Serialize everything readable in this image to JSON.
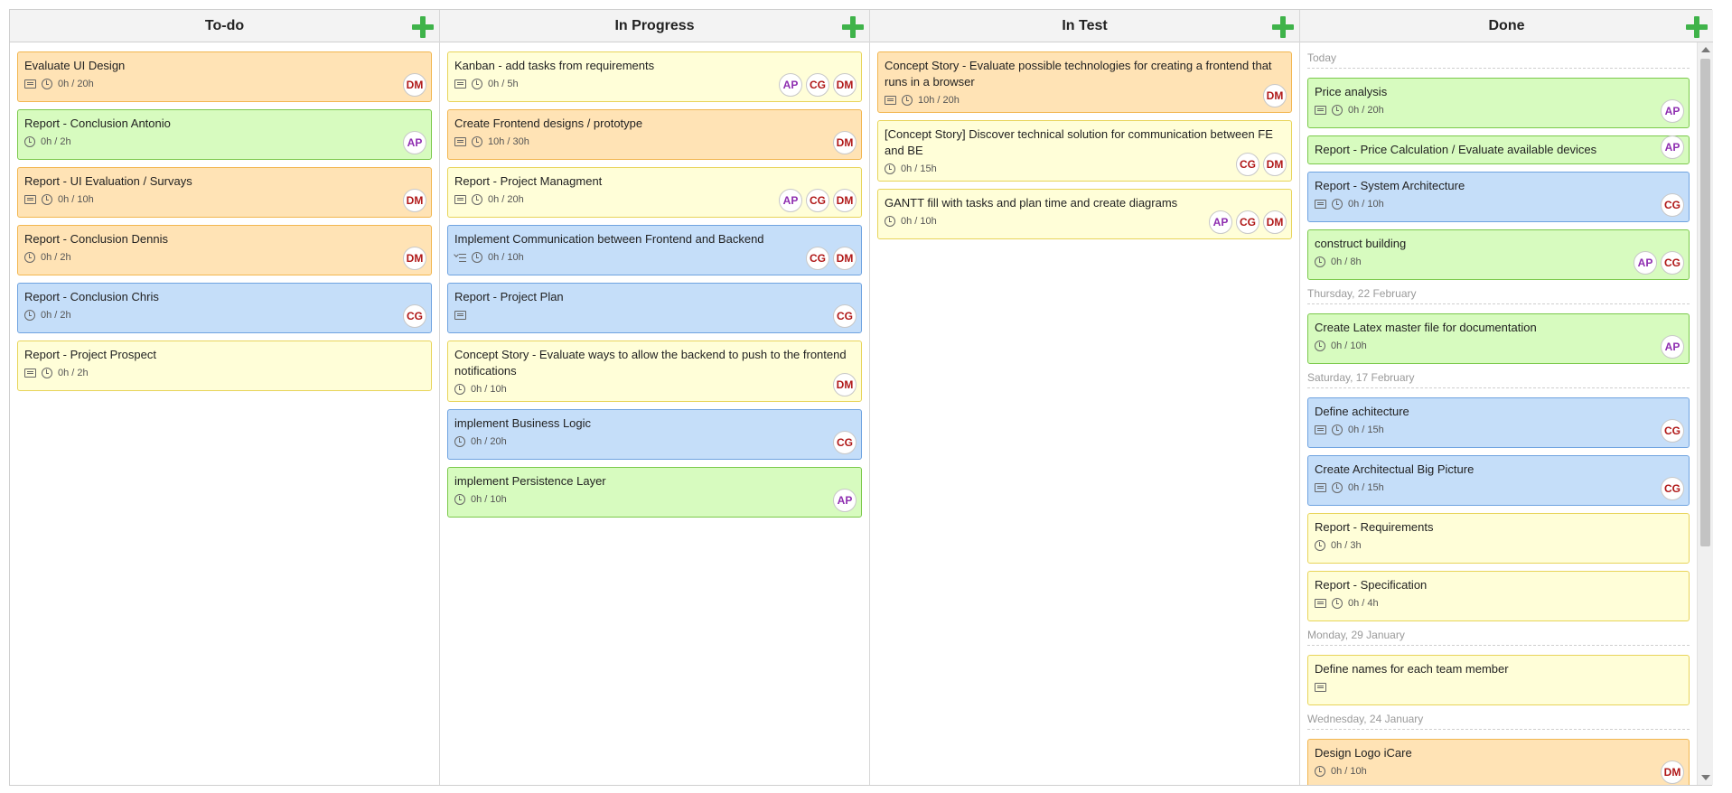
{
  "colors": {
    "orange": "#ffe3b5",
    "green": "#d7fbbf",
    "blue": "#c5def9",
    "yellow": "#fffed8",
    "add": "#3fb34a"
  },
  "columns": [
    {
      "title": "To-do",
      "cards": [
        {
          "title": "Evaluate UI Design",
          "color": "orange",
          "desc": true,
          "time": "0h / 20h",
          "avatars": [
            "DM"
          ]
        },
        {
          "title": "Report - Conclusion Antonio",
          "color": "green",
          "desc": false,
          "time": "0h / 2h",
          "avatars": [
            "AP"
          ]
        },
        {
          "title": "Report - UI Evaluation / Survays",
          "color": "orange",
          "desc": true,
          "time": "0h / 10h",
          "avatars": [
            "DM"
          ]
        },
        {
          "title": "Report - Conclusion Dennis",
          "color": "orange",
          "desc": false,
          "time": "0h / 2h",
          "avatars": [
            "DM"
          ]
        },
        {
          "title": "Report - Conclusion Chris",
          "color": "blue",
          "desc": false,
          "time": "0h / 2h",
          "avatars": [
            "CG"
          ]
        },
        {
          "title": "Report - Project Prospect",
          "color": "yellow",
          "desc": true,
          "time": "0h / 2h",
          "avatars": []
        }
      ]
    },
    {
      "title": "In Progress",
      "cards": [
        {
          "title": "Kanban - add tasks from requirements",
          "color": "yellow",
          "desc": true,
          "time": "0h / 5h",
          "avatars": [
            "AP",
            "CG",
            "DM"
          ]
        },
        {
          "title": "Create Frontend designs / prototype",
          "color": "orange",
          "desc": true,
          "time": "10h / 30h",
          "avatars": [
            "DM"
          ]
        },
        {
          "title": "Report - Project Managment",
          "color": "yellow",
          "desc": true,
          "time": "0h / 20h",
          "avatars": [
            "AP",
            "CG",
            "DM"
          ]
        },
        {
          "title": "Implement Communication between Frontend and Backend",
          "color": "blue",
          "checklist": true,
          "time": "0h / 10h",
          "avatars": [
            "CG",
            "DM"
          ]
        },
        {
          "title": "Report - Project Plan",
          "color": "blue",
          "desc": true,
          "time": "",
          "avatars": [
            "CG"
          ]
        },
        {
          "title": "Concept Story - Evaluate ways to allow the backend to push to the frontend notifications",
          "color": "yellow",
          "desc": false,
          "time": "0h / 10h",
          "avatars": [
            "DM"
          ]
        },
        {
          "title": "implement Business Logic",
          "color": "blue",
          "desc": false,
          "time": "0h / 20h",
          "avatars": [
            "CG"
          ]
        },
        {
          "title": "implement Persistence Layer",
          "color": "green",
          "desc": false,
          "time": "0h / 10h",
          "avatars": [
            "AP"
          ]
        }
      ]
    },
    {
      "title": "In Test",
      "cards": [
        {
          "title": "Concept Story - Evaluate possible technologies for creating a frontend that runs in a browser",
          "color": "orange",
          "desc": true,
          "time": "10h / 20h",
          "avatars": [
            "DM"
          ]
        },
        {
          "title": "[Concept Story] Discover technical solution for communication between FE and BE",
          "color": "yellow",
          "desc": false,
          "time": "0h / 15h",
          "avatars": [
            "CG",
            "DM"
          ]
        },
        {
          "title": "GANTT fill with tasks and plan time and create diagrams",
          "color": "yellow",
          "desc": false,
          "time": "0h / 10h",
          "avatars": [
            "AP",
            "CG",
            "DM"
          ]
        }
      ]
    },
    {
      "title": "Done",
      "groups": [
        {
          "label": "Today",
          "cards": [
            {
              "title": "Price analysis",
              "color": "green",
              "desc": true,
              "time": "0h / 20h",
              "avatars": [
                "AP"
              ]
            },
            {
              "title": "Report - Price Calculation / Evaluate available devices",
              "color": "green",
              "desc": false,
              "time": "",
              "avatars": [
                "AP"
              ],
              "compact": true
            },
            {
              "title": "Report - System Architecture",
              "color": "blue",
              "desc": true,
              "time": "0h / 10h",
              "avatars": [
                "CG"
              ]
            },
            {
              "title": "construct building",
              "color": "green",
              "desc": false,
              "time": "0h / 8h",
              "avatars": [
                "AP",
                "CG"
              ]
            }
          ]
        },
        {
          "label": "Thursday, 22 February",
          "cards": [
            {
              "title": "Create Latex master file for documentation",
              "color": "green",
              "desc": false,
              "time": "0h / 10h",
              "avatars": [
                "AP"
              ]
            }
          ]
        },
        {
          "label": "Saturday, 17 February",
          "cards": [
            {
              "title": "Define achitecture",
              "color": "blue",
              "desc": true,
              "time": "0h / 15h",
              "avatars": [
                "CG"
              ]
            },
            {
              "title": "Create Architectual Big Picture",
              "color": "blue",
              "desc": true,
              "time": "0h / 15h",
              "avatars": [
                "CG"
              ]
            },
            {
              "title": "Report - Requirements",
              "color": "yellow",
              "desc": false,
              "time": "0h / 3h",
              "avatars": []
            },
            {
              "title": "Report - Specification",
              "color": "yellow",
              "desc": true,
              "time": "0h / 4h",
              "avatars": []
            }
          ]
        },
        {
          "label": "Monday, 29 January",
          "cards": [
            {
              "title": "Define names for each team member",
              "color": "yellow",
              "desc": true,
              "time": "",
              "avatars": []
            }
          ]
        },
        {
          "label": "Wednesday, 24 January",
          "cards": [
            {
              "title": "Design Logo iCare",
              "color": "orange",
              "desc": false,
              "time": "0h / 10h",
              "avatars": [
                "DM"
              ]
            }
          ]
        }
      ]
    }
  ]
}
